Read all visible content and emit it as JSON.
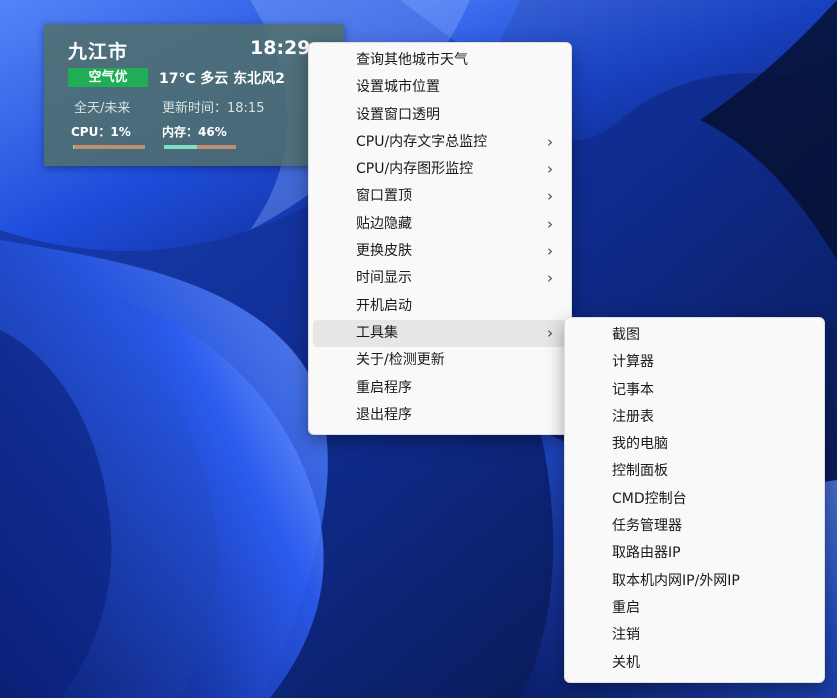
{
  "colors": {
    "widget_bg": "#506e6c",
    "aqi_badge": "#1fae55",
    "bar_track": "#c0906e",
    "bar_fill": "#7fe0c2",
    "menu_bg": "#f9f9f9",
    "menu_active": "#e6e6e6"
  },
  "widget": {
    "city": "九江市",
    "time": "18:29",
    "aqi": "空气优",
    "weather": "17℃ 多云 东北风2",
    "forecast": "全天/未来",
    "update_time": "更新时间：18:15",
    "cpu": "CPU：1%",
    "cpu_percent": 1,
    "memory": "内存：46%",
    "memory_percent": 46
  },
  "main_menu": {
    "items": [
      {
        "label": "查询其他城市天气",
        "submenu": false
      },
      {
        "label": "设置城市位置",
        "submenu": false
      },
      {
        "label": "设置窗口透明",
        "submenu": false
      },
      {
        "label": "CPU/内存文字总监控",
        "submenu": true
      },
      {
        "label": "CPU/内存图形监控",
        "submenu": true
      },
      {
        "label": "窗口置顶",
        "submenu": true
      },
      {
        "label": "贴边隐藏",
        "submenu": true
      },
      {
        "label": "更换皮肤",
        "submenu": true
      },
      {
        "label": "时间显示",
        "submenu": true
      },
      {
        "label": "开机启动",
        "submenu": false
      },
      {
        "label": "工具集",
        "submenu": true,
        "active": true
      },
      {
        "label": "关于/检测更新",
        "submenu": false
      },
      {
        "label": "重启程序",
        "submenu": false
      },
      {
        "label": "退出程序",
        "submenu": false
      }
    ],
    "arrow_glyph": "›"
  },
  "tools_menu": {
    "items": [
      "截图",
      "计算器",
      "记事本",
      "注册表",
      "我的电脑",
      "控制面板",
      "CMD控制台",
      "任务管理器",
      "取路由器IP",
      "取本机内网IP/外网IP",
      "重启",
      "注销",
      "关机"
    ]
  }
}
